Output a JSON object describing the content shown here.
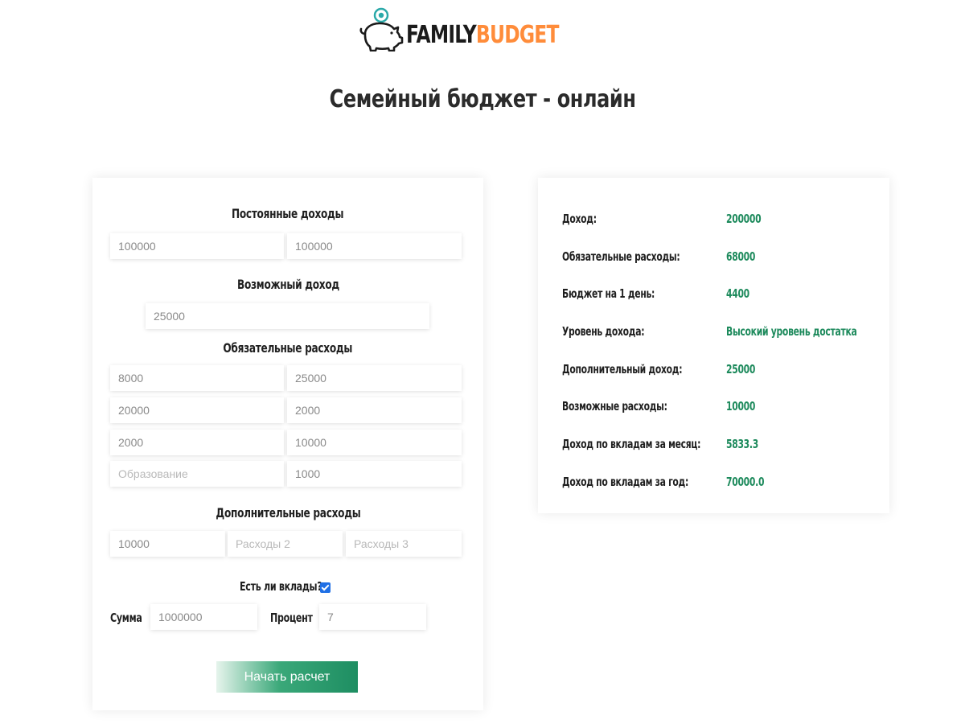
{
  "logo": {
    "part1": "FAMILY",
    "part2": "BUDGET",
    "icon": "piggy-bank-icon",
    "colors": {
      "dark": "#1b1b1b",
      "accent": "#ff8c3a",
      "icon": "#2aa9a9"
    }
  },
  "page_title": "Семейный бюджет - онлайн",
  "form": {
    "constant_income": {
      "title": "Постоянные доходы",
      "fields": [
        {
          "value": "100000"
        },
        {
          "value": "100000"
        }
      ]
    },
    "possible_income": {
      "title": "Возможный доход",
      "field": {
        "value": "25000"
      }
    },
    "mandatory_expenses": {
      "title": "Обязательные расходы",
      "fields": [
        {
          "value": "8000"
        },
        {
          "value": "25000"
        },
        {
          "value": "20000"
        },
        {
          "value": "2000"
        },
        {
          "value": "2000"
        },
        {
          "value": "10000"
        },
        {
          "value": "",
          "placeholder": "Образование"
        },
        {
          "value": "1000"
        }
      ]
    },
    "additional_expenses": {
      "title": "Дополнительные расходы",
      "fields": [
        {
          "value": "10000"
        },
        {
          "value": "",
          "placeholder": "Расходы 2"
        },
        {
          "value": "",
          "placeholder": "Расходы 3"
        }
      ]
    },
    "deposits": {
      "question": "Есть ли вклады?",
      "checked": true,
      "sum_label": "Сумма",
      "sum_value": "1000000",
      "percent_label": "Процент",
      "percent_value": "7"
    },
    "submit_label": "Начать расчет"
  },
  "results": [
    {
      "label": "Доход:",
      "value": "200000"
    },
    {
      "label": "Обязательные расходы:",
      "value": "68000"
    },
    {
      "label": "Бюджет на 1 день:",
      "value": "4400"
    },
    {
      "label": "Уровень дохода:",
      "value": "Высокий уровень достатка"
    },
    {
      "label": "Дополнительный доход:",
      "value": "25000"
    },
    {
      "label": "Возможные расходы:",
      "value": "10000"
    },
    {
      "label": "Доход по вкладам за месяц:",
      "value": "5833.3"
    },
    {
      "label": "Доход по вкладам за год:",
      "value": "70000.0"
    }
  ],
  "colors": {
    "value_green": "#1d8a5c",
    "checkbox_blue": "#1f6fe5"
  }
}
